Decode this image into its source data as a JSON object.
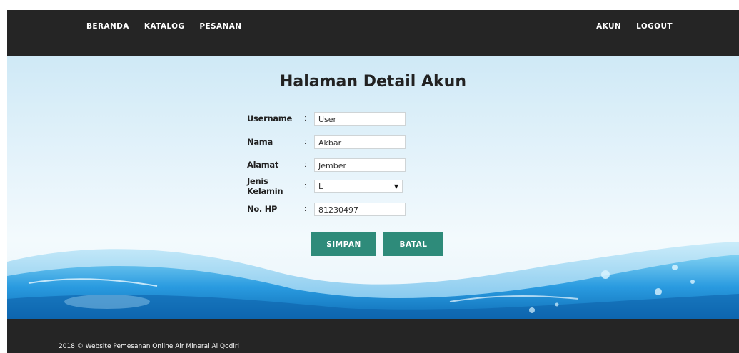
{
  "nav": {
    "left": [
      {
        "label": "BERANDA"
      },
      {
        "label": "KATALOG"
      },
      {
        "label": "PESANAN"
      }
    ],
    "right": [
      {
        "label": "AKUN"
      },
      {
        "label": "LOGOUT"
      }
    ]
  },
  "page": {
    "title": "Halaman Detail Akun"
  },
  "form": {
    "username": {
      "label": "Username",
      "colon": ":",
      "value": "User"
    },
    "nama": {
      "label": "Nama",
      "colon": ":",
      "value": "Akbar"
    },
    "alamat": {
      "label": "Alamat",
      "colon": ":",
      "value": "Jember"
    },
    "jenis_kelamin": {
      "label": "Jenis Kelamin",
      "colon": ":",
      "value": "L"
    },
    "no_hp": {
      "label": "No. HP",
      "colon": ":",
      "value": "81230497"
    }
  },
  "buttons": {
    "save": "SIMPAN",
    "cancel": "BATAL"
  },
  "footer": {
    "text": "2018 © Website Pemesanan Online Air Mineral Al Qodiri"
  },
  "colors": {
    "navbar": "#252525",
    "button": "#2e8b7a",
    "water": "#1f8fd6"
  }
}
